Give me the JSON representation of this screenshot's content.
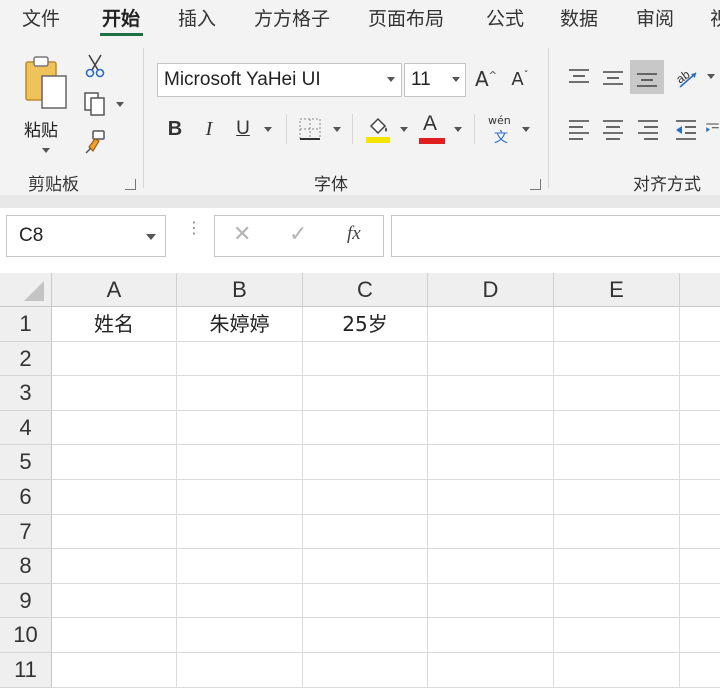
{
  "tabs": [
    {
      "label": "文件",
      "active": false
    },
    {
      "label": "开始",
      "active": true
    },
    {
      "label": "插入",
      "active": false
    },
    {
      "label": "方方格子",
      "active": false
    },
    {
      "label": "页面布局",
      "active": false
    },
    {
      "label": "公式",
      "active": false
    },
    {
      "label": "数据",
      "active": false
    },
    {
      "label": "审阅",
      "active": false
    },
    {
      "label": "视",
      "active": false
    }
  ],
  "ribbon": {
    "clipboard": {
      "paste_label": "粘贴",
      "group_label": "剪贴板"
    },
    "font": {
      "font_name": "Microsoft YaHei UI",
      "font_size": "11",
      "group_label": "字体",
      "bold": "B",
      "italic": "I",
      "underline": "U",
      "font_color_glyph": "A",
      "phonetic_top": "wén",
      "phonetic_bottom": "文",
      "highlight_color": "#f5e400",
      "font_color": "#e02020"
    },
    "alignment": {
      "group_label": "对齐方式"
    }
  },
  "formula_bar": {
    "name_box": "C8",
    "fx_label": "fx",
    "formula_value": ""
  },
  "sheet": {
    "columns": [
      "A",
      "B",
      "C",
      "D",
      "E"
    ],
    "rows": [
      "1",
      "2",
      "3",
      "4",
      "5",
      "6",
      "7",
      "8",
      "9",
      "10",
      "11"
    ],
    "cells": {
      "A1": "姓名",
      "B1": "朱婷婷",
      "C1": "25岁"
    }
  },
  "colors": {
    "accent": "#1e7145",
    "ribbon_bg": "#f3f3f3"
  }
}
